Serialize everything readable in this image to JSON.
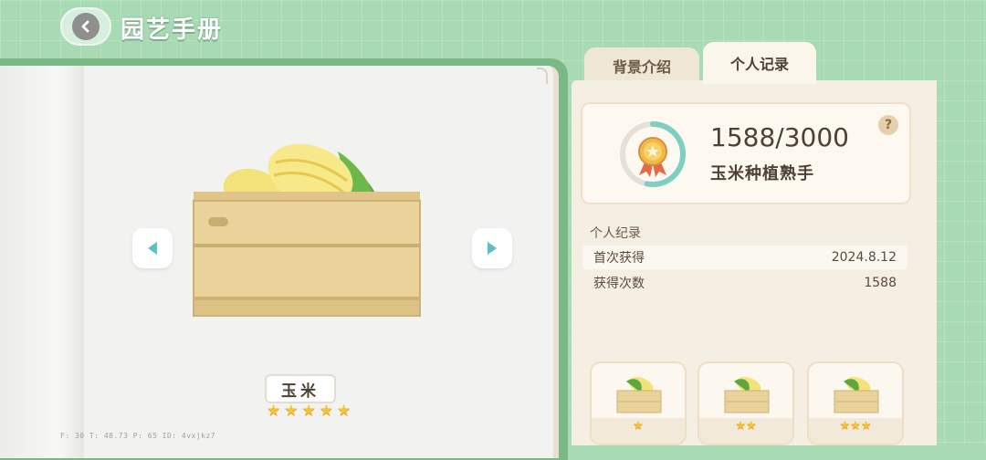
{
  "header": {
    "title": "园艺手册"
  },
  "item": {
    "name": "玉米",
    "stars": "★★★★★"
  },
  "tabs": [
    {
      "label": "背景介绍",
      "active": false
    },
    {
      "label": "个人记录",
      "active": true
    }
  ],
  "stats": {
    "count": "1588/3000",
    "rank": "玉米种植熟手",
    "progress": 0.53,
    "help": "?"
  },
  "records": {
    "title": "个人纪录",
    "rows": [
      {
        "label": "首次获得",
        "value": "2024.8.12"
      },
      {
        "label": "获得次数",
        "value": "1588"
      }
    ]
  },
  "variants": [
    {
      "stars": "★"
    },
    {
      "stars": "★★"
    },
    {
      "stars": "★★★"
    }
  ],
  "debug": "F: 30   T: 48.73   P: 65   ID: 4vxjkz7",
  "colors": {
    "background": "#a8dbb4",
    "accent": "#f5c339",
    "panel": "#f5efe3"
  }
}
